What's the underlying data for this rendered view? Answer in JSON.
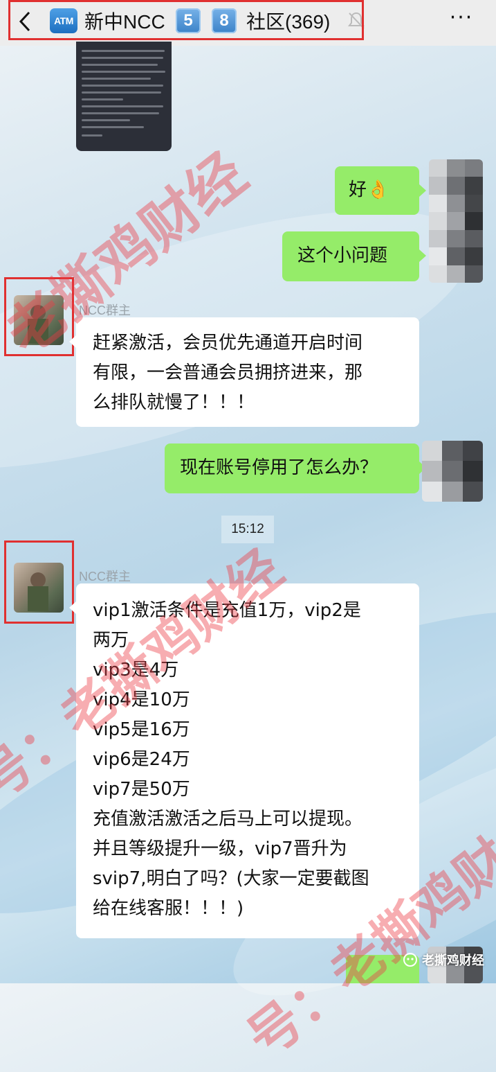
{
  "header": {
    "back_icon": "chevron-left-icon",
    "atm_badge": "ATM",
    "title_main": "新中NCC",
    "badge_5": "5",
    "badge_8": "8",
    "title_community": "社区(369)",
    "mute_icon": "bell-muted-icon",
    "more_label": "···"
  },
  "messages": [
    {
      "side": "left",
      "type": "image",
      "desc": "dark screenshot with small text",
      "icon": "image-thumbnail"
    },
    {
      "side": "right",
      "text": "好👌"
    },
    {
      "side": "right",
      "text": "这个小问题"
    },
    {
      "side": "left",
      "sender": "NCC群主",
      "lines": [
        "赶紧激活，会员优先通道开启时间",
        "有限，一会普通会员拥挤进来，那",
        "么排队就慢了！！！"
      ]
    },
    {
      "side": "right",
      "text": "现在账号停用了怎么办？"
    },
    {
      "side": "left",
      "sender": "NCC群主",
      "lines": [
        "vip1激活条件是充值1万，vip2是",
        "两万",
        "vip3是4万",
        "vip4是10万",
        "vip5是16万",
        "vip6是24万",
        "vip7是50万",
        "充值激活激活之后马上可以提现。",
        "并且等级提升一级，vip7晋升为",
        "svip7,明白了吗？(大家一定要截图",
        "给在线客服！！！)"
      ]
    }
  ],
  "time_label": "15:12",
  "watermarks": [
    "老撕鸡财经",
    "号：老撕鸡财经",
    "号：老撕鸡财"
  ],
  "brand": {
    "icon": "wechat-official-account-icon",
    "label": "老撕鸡财经"
  },
  "colors": {
    "my_bubble": "#95ec69",
    "their_bubble": "#ffffff",
    "highlight_box": "#e03030",
    "watermark": "#eb3c46"
  }
}
